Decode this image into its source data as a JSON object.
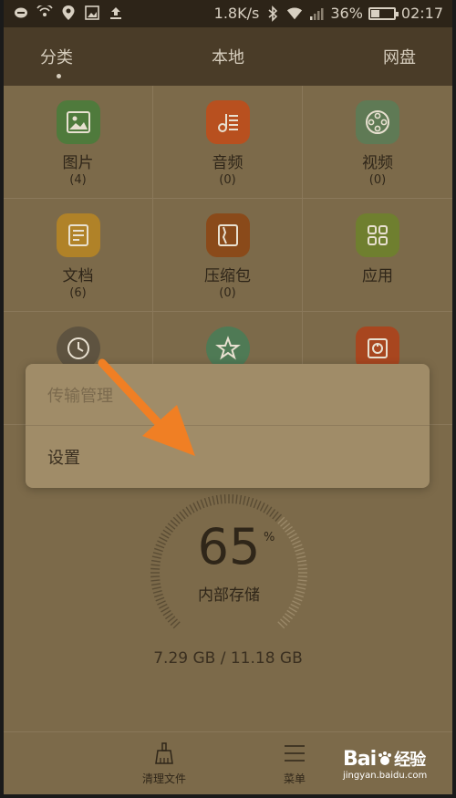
{
  "status_bar": {
    "speed": "1.8K/s",
    "battery_percent": "36%",
    "battery_level": 0.36,
    "time": "02:17",
    "left_icons": [
      "message-icon",
      "wifi-hotspot-icon",
      "location-icon",
      "gallery-icon",
      "upload-icon"
    ],
    "right_icons": [
      "bluetooth-icon",
      "wifi-icon",
      "signal-icon"
    ]
  },
  "tabs": {
    "items": [
      {
        "label": "分类",
        "active": true
      },
      {
        "label": "本地",
        "active": false
      },
      {
        "label": "网盘",
        "active": false
      }
    ]
  },
  "categories": [
    {
      "label": "图片",
      "count": "(4)",
      "icon": "image-icon",
      "color": "#4f7a3c"
    },
    {
      "label": "音频",
      "count": "(0)",
      "icon": "music-icon",
      "color": "#b8501f"
    },
    {
      "label": "视频",
      "count": "(0)",
      "icon": "film-reel-icon",
      "color": "#5f7a55"
    },
    {
      "label": "文档",
      "count": "(6)",
      "icon": "document-icon",
      "color": "#b08228"
    },
    {
      "label": "压缩包",
      "count": "(0)",
      "icon": "archive-icon",
      "color": "#8a4a1a"
    },
    {
      "label": "应用",
      "count": "",
      "icon": "apps-grid-icon",
      "color": "#6f7f2f"
    },
    {
      "label": "",
      "count": "",
      "icon": "clock-icon",
      "color": "#5e5340"
    },
    {
      "label": "",
      "count": "",
      "icon": "star-icon",
      "color": "#4f7a55"
    },
    {
      "label": "",
      "count": "",
      "icon": "safe-icon",
      "color": "#a8461f"
    }
  ],
  "popup_menu": {
    "items": [
      {
        "label": "传输管理",
        "enabled": false
      },
      {
        "label": "设置",
        "enabled": true
      }
    ]
  },
  "storage": {
    "percent": "65",
    "percent_value": 65,
    "percent_sign": "%",
    "label": "内部存储",
    "usage": "7.29 GB / 11.18 GB"
  },
  "bottom_bar": {
    "clean_label": "清理文件",
    "menu_label": "菜单"
  },
  "watermark": {
    "logo": "Bai",
    "logo2": "经验",
    "url": "jingyan.baidu.com"
  }
}
